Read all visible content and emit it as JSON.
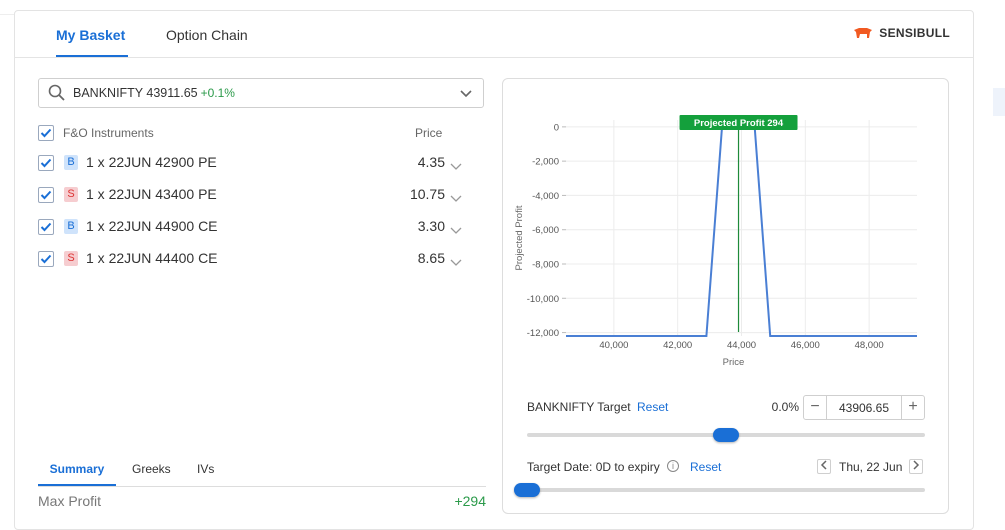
{
  "tabs": [
    {
      "label": "My Basket",
      "active": true
    },
    {
      "label": "Option Chain",
      "active": false
    }
  ],
  "brand": {
    "name": "SENSIBULL",
    "color": "#f15a22"
  },
  "search": {
    "symbol": "BANKNIFTY 43911.65",
    "change": "+0.1%"
  },
  "table": {
    "header": {
      "instruments": "F&O Instruments",
      "price": "Price"
    },
    "rows": [
      {
        "side": "B",
        "instrument": "1 x 22JUN 42900 PE",
        "price": "4.35",
        "checked": true
      },
      {
        "side": "S",
        "instrument": "1 x 22JUN 43400 PE",
        "price": "10.75",
        "checked": true
      },
      {
        "side": "B",
        "instrument": "1 x 22JUN 44900 CE",
        "price": "3.30",
        "checked": true
      },
      {
        "side": "S",
        "instrument": "1 x 22JUN 44400 CE",
        "price": "8.65",
        "checked": true
      }
    ]
  },
  "bottom_tabs": [
    {
      "label": "Summary",
      "active": true
    },
    {
      "label": "Greeks",
      "active": false
    },
    {
      "label": "IVs",
      "active": false
    }
  ],
  "summary": {
    "max_profit_label": "Max Profit",
    "max_profit_value": "+294"
  },
  "target": {
    "label": "BANKNIFTY Target",
    "reset": "Reset",
    "pct": "0.0%",
    "value": "43906.65",
    "minus": "−",
    "plus": "+",
    "slider_fraction": 0.5
  },
  "target_date": {
    "label": "Target Date:  0D to expiry",
    "info": "i",
    "reset": "Reset",
    "date": "Thu, 22 Jun",
    "slider_fraction": 0.0
  },
  "colors": {
    "accent": "#1a6fd6",
    "profit": "#2b9a4a",
    "loss": "#d33333",
    "payoff_line": "#4a7fd4"
  },
  "chart_data": {
    "type": "line",
    "xlabel": "Price",
    "ylabel": "Projected Profit",
    "x_ticks": [
      40000,
      42000,
      44000,
      46000,
      48000
    ],
    "x_tick_labels": [
      "40,000",
      "42,000",
      "44,000",
      "46,000",
      "48,000"
    ],
    "y_ticks": [
      0,
      -2000,
      -4000,
      -6000,
      -8000,
      -10000,
      -12000
    ],
    "y_tick_labels": [
      "0",
      "-2,000",
      "-4,000",
      "-6,000",
      "-8,000",
      "-10,000",
      "-12,000"
    ],
    "xlim": [
      38500,
      49500
    ],
    "ylim": [
      -12200,
      400
    ],
    "series": [
      {
        "x": [
          38500,
          42900,
          43400,
          44400,
          44900,
          49500
        ],
        "y": [
          -12200,
          -12200,
          294,
          294,
          -12200,
          -12200
        ]
      }
    ],
    "marker": {
      "x": 43906.65,
      "label": "Projected Profit 294"
    },
    "grid": true
  }
}
